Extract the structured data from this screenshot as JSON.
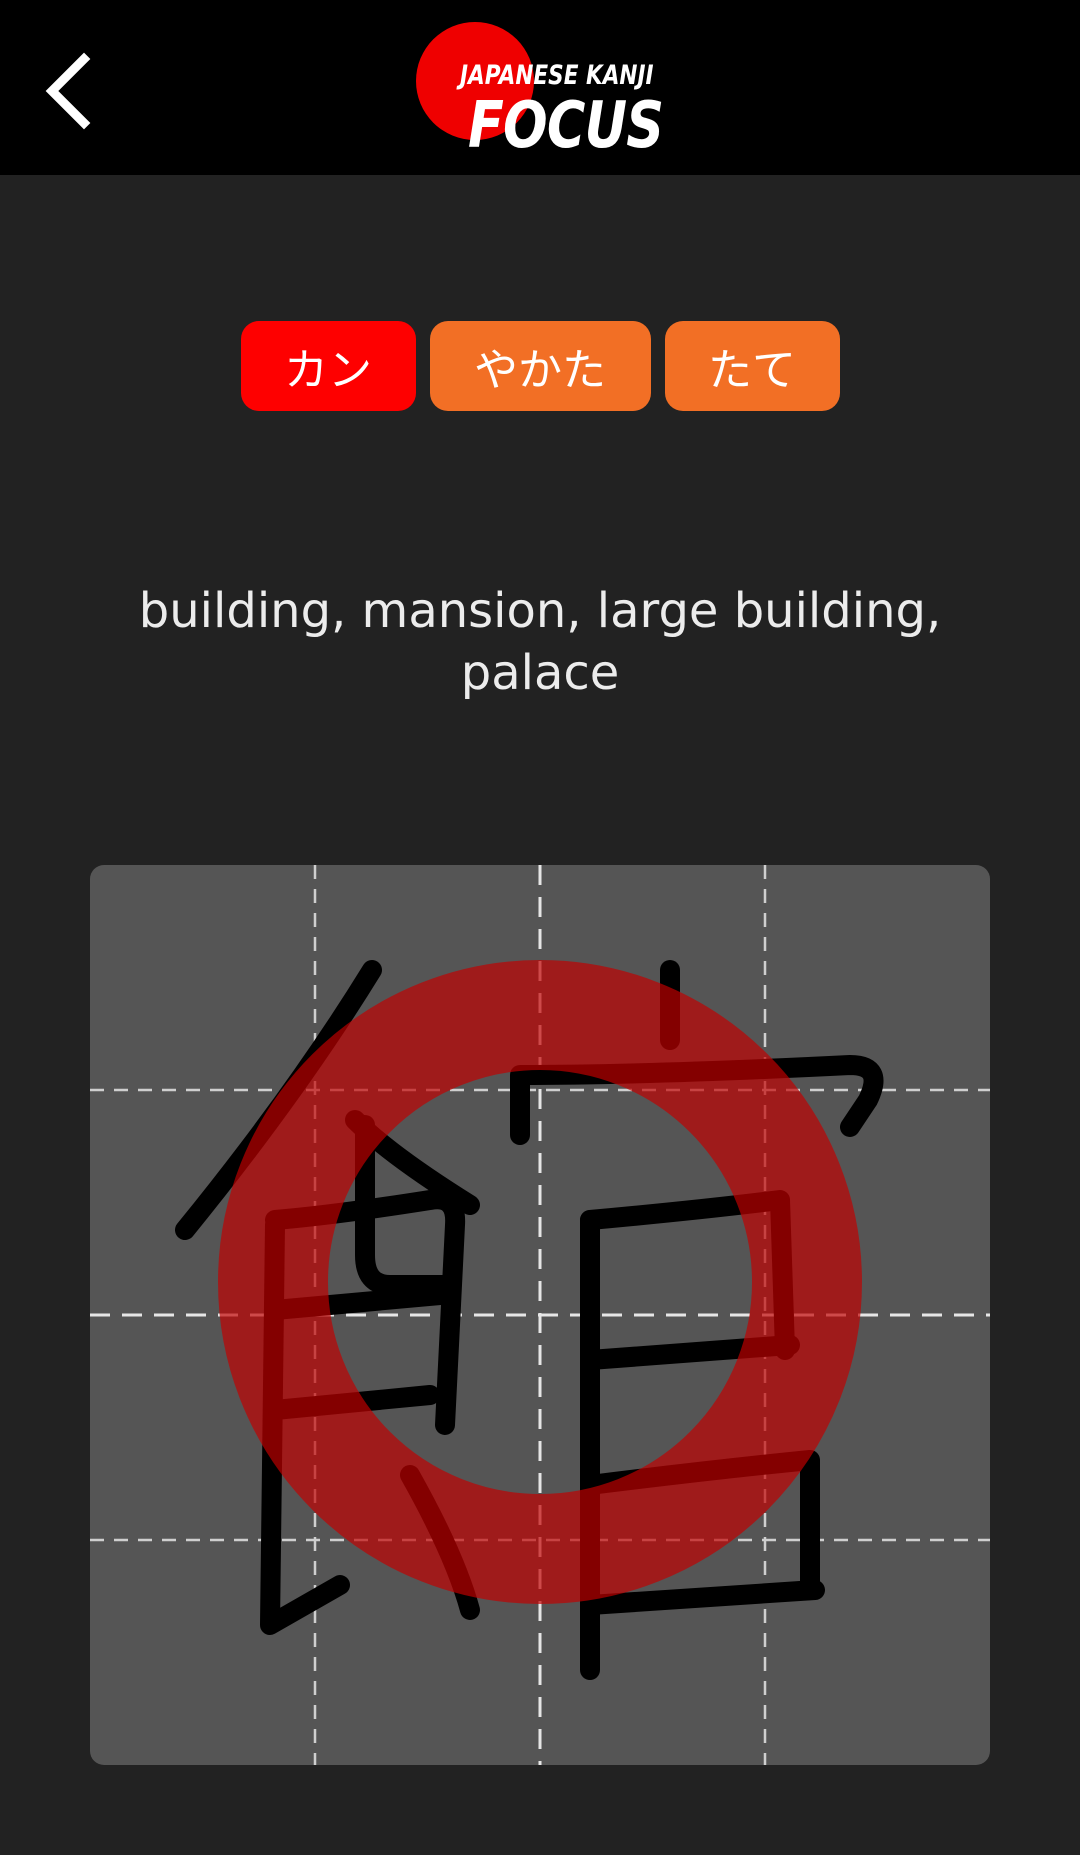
{
  "header": {
    "logo": {
      "line1": "JAPANESE KANJI",
      "line2": "FOCUS",
      "sun_color": "#ef0000"
    },
    "back_icon": "chevron-left-icon"
  },
  "readings": [
    {
      "text": "カン",
      "kind": "on",
      "color": "#fe0000"
    },
    {
      "text": "やかた",
      "kind": "kun",
      "color": "#f26f25"
    },
    {
      "text": "たて",
      "kind": "kun",
      "color": "#f26f25"
    }
  ],
  "meaning": "building, mansion, large building, palace",
  "writing_area": {
    "kanji": "館",
    "result_mark": "red-circle-correct",
    "background": "#555555",
    "guide_lines": "dashed 4x4 grid"
  }
}
